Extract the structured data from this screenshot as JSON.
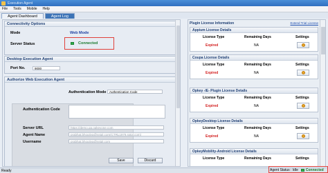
{
  "window": {
    "title": "Execution Agent"
  },
  "menu": [
    "File",
    "Tools",
    "Mobile",
    "Help"
  ],
  "tabs": [
    {
      "label": "Agent Dashboard",
      "active": false
    },
    {
      "label": "Agent Log",
      "active": true
    }
  ],
  "connectivity": {
    "header": "Connectivity Options",
    "mode_label": "Mode",
    "mode_value": "Web Mode",
    "server_status_label": "Server Status",
    "server_status_value": "Connected"
  },
  "desktop": {
    "header": "Desktop Execution Agent",
    "port_label": "Port No.",
    "port_value": "9000"
  },
  "web_agent": {
    "header": "Authorize Web Execution Agent",
    "auth_mode_label": "Authentication Mode",
    "auth_mode_value": "Authentication Code",
    "auth_code_label": "Authentication Code",
    "server_url_label": "Server URL",
    "server_url_value": "https://demo.qa.opkeyone.com",
    "agent_name_label": "Agent Name",
    "agent_name_value": "prabhat.bhoutiya@sstpl.com(CTRL1979.sstpl.com)",
    "username_label": "Username",
    "username_value": "prabhat.bhoutiya@sstpl.com",
    "save_label": "Save",
    "discard_label": "Discard"
  },
  "plugin": {
    "header": "Plugin License Information",
    "extend_link": "Extend Trial License",
    "columns": {
      "type": "License Type",
      "days": "Remaining Days",
      "settings": "Settings"
    },
    "licenses": [
      {
        "title": "Appium License Details",
        "type": "Expired",
        "days": "NA"
      },
      {
        "title": "Coupa License Details",
        "type": "Expired",
        "days": "NA"
      },
      {
        "title": "Opkey -IE- Plugin License Details",
        "type": "Expired",
        "days": "NA"
      },
      {
        "title": "OpkeyDesktop License Details",
        "type": "Expired",
        "days": "NA"
      },
      {
        "title": "OpkeyMobility-Android License Details",
        "type": "",
        "days": ""
      }
    ]
  },
  "statusbar": {
    "left": "Ready",
    "agent_status_label": "Agent Status : Idle",
    "connection": "Connected"
  },
  "colors": {
    "accent": "#3c73b6",
    "highlight": "#e0403a",
    "expired": "#d21e1e",
    "connected": "#1a7a2e"
  }
}
